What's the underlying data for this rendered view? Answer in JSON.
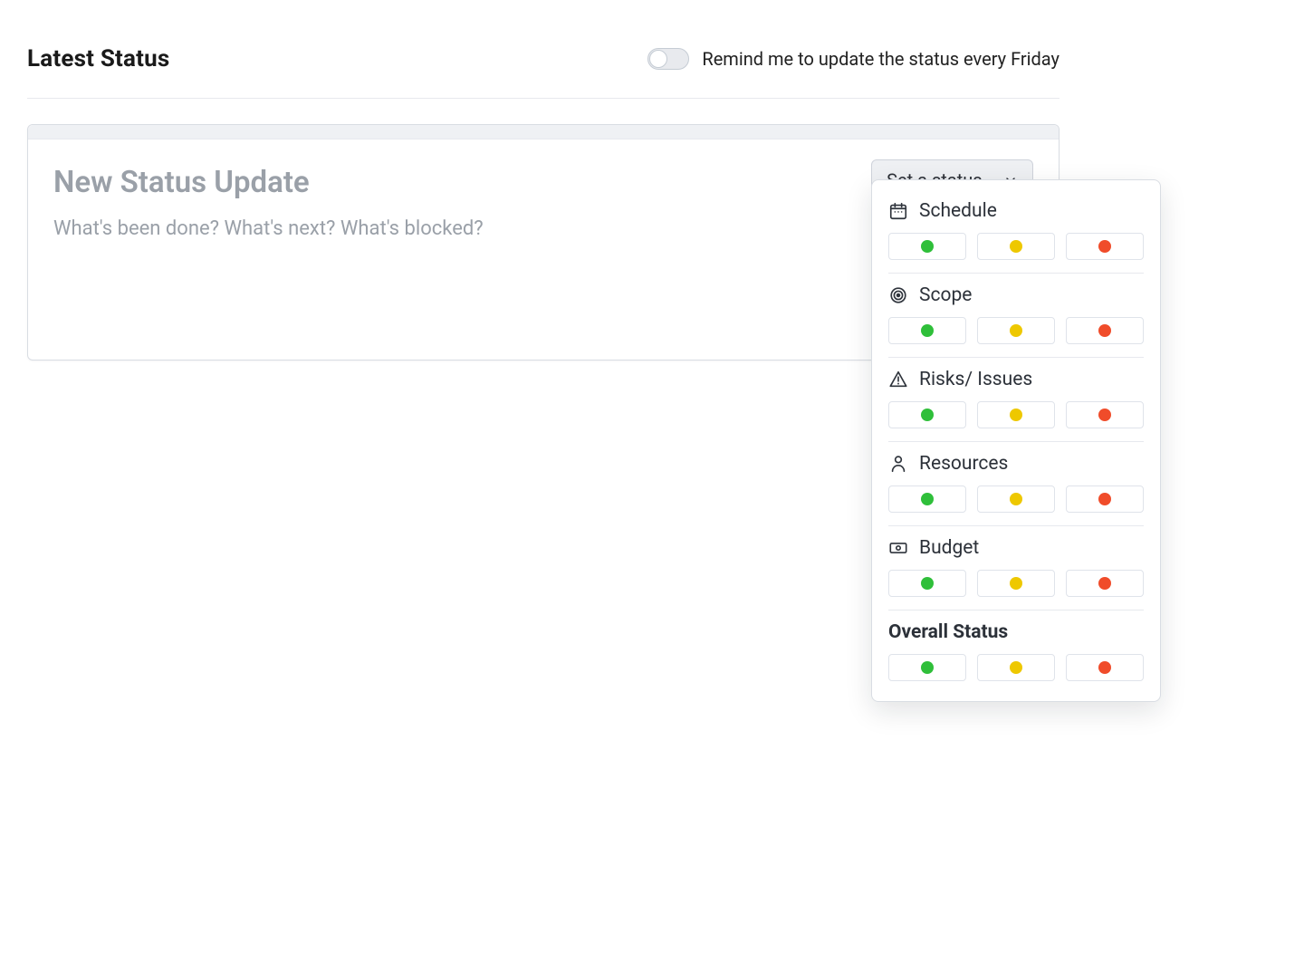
{
  "header": {
    "title": "Latest Status",
    "remind_label": "Remind me to update the status every Friday",
    "remind_on": false
  },
  "card": {
    "title_placeholder": "New Status Update",
    "body_placeholder": "What's been done? What's next? What's blocked?",
    "status_button_label": "Set a status…"
  },
  "popover": {
    "sections": [
      {
        "icon": "calendar-icon",
        "title": "Schedule",
        "bold": false
      },
      {
        "icon": "target-icon",
        "title": "Scope",
        "bold": false
      },
      {
        "icon": "warning-icon",
        "title": "Risks/ Issues",
        "bold": false
      },
      {
        "icon": "person-icon",
        "title": "Resources",
        "bold": false
      },
      {
        "icon": "money-icon",
        "title": "Budget",
        "bold": false
      },
      {
        "icon": "",
        "title": "Overall Status",
        "bold": true
      }
    ],
    "option_colors": [
      "green",
      "yellow",
      "red"
    ]
  },
  "colors": {
    "green": "#2fbf3a",
    "yellow": "#eec800",
    "red": "#f04c2a"
  }
}
